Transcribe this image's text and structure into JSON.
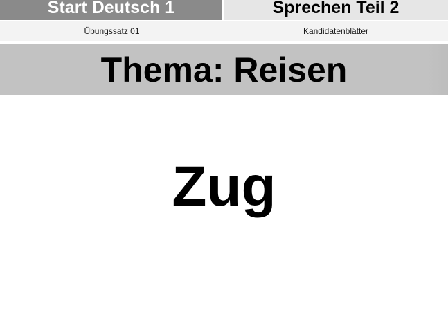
{
  "header": {
    "exam_name": "Start Deutsch 1",
    "section_name": "Sprechen Teil 2",
    "set_label": "Übungssatz 01",
    "sheet_label": "Kandidatenblätter"
  },
  "theme": {
    "title": "Thema: Reisen"
  },
  "card": {
    "word": "Zug"
  },
  "colors": {
    "exam_name_bg": "#8a8a8a",
    "section_name_bg": "#e6e6e6",
    "sub_row_bg": "#f3f3f3",
    "theme_bar_bg": "#c2c2c2"
  }
}
